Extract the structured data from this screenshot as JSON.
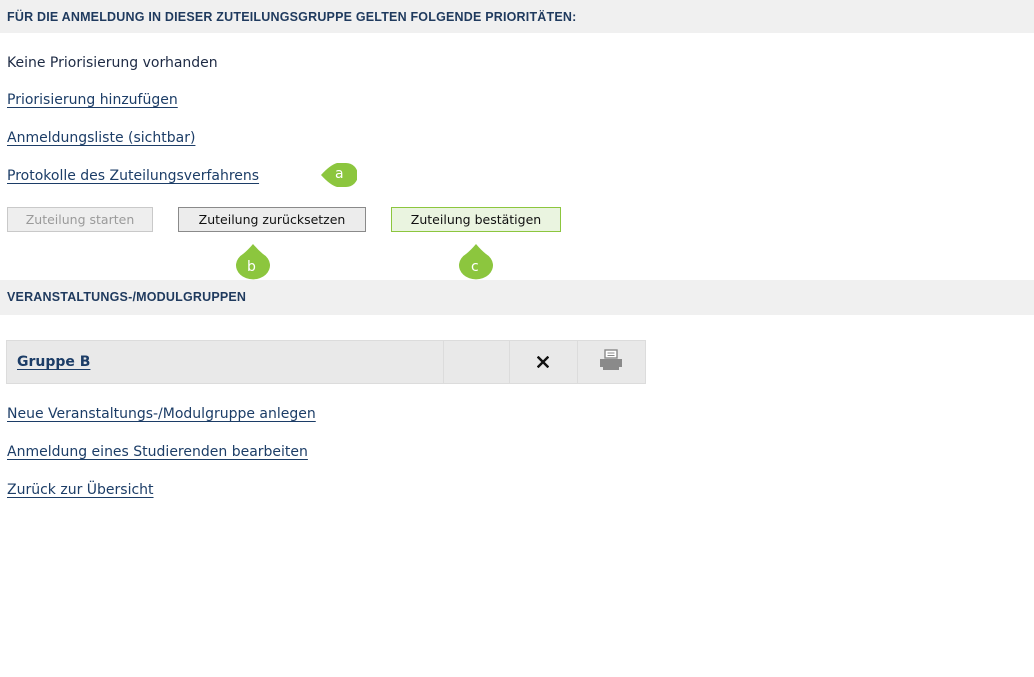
{
  "priorities": {
    "header": "FÜR DIE ANMELDUNG IN DIESER ZUTEILUNGSGRUPPE GELTEN FOLGENDE PRIORITÄTEN:",
    "none_text": "Keine Priorisierung vorhanden",
    "add_link": "Priorisierung hinzufügen",
    "list_link": "Anmeldungsliste (sichtbar)",
    "protocol_link": "Protokolle des Zuteilungsverfahrens"
  },
  "buttons": {
    "start": "Zuteilung starten",
    "reset": "Zuteilung zurücksetzen",
    "confirm": "Zuteilung bestätigen"
  },
  "markers": {
    "a": "a",
    "b": "b",
    "c": "c",
    "color": "#8cc63e"
  },
  "groups": {
    "header": "VERANSTALTUNGS-/MODULGRUPPEN",
    "rows": [
      {
        "name": "Gruppe B",
        "delete_icon": "close-icon",
        "print_icon": "printer-icon"
      }
    ],
    "new_link": "Neue Veranstaltungs-/Modulgruppe anlegen",
    "edit_link": "Anmeldung eines Studierenden bearbeiten",
    "back_link": "Zurück zur Übersicht"
  },
  "colors": {
    "header_bg": "#f0f0f0",
    "header_text": "#1f3a5e",
    "link": "#1c3d67",
    "accent_green": "#8cc63e"
  }
}
